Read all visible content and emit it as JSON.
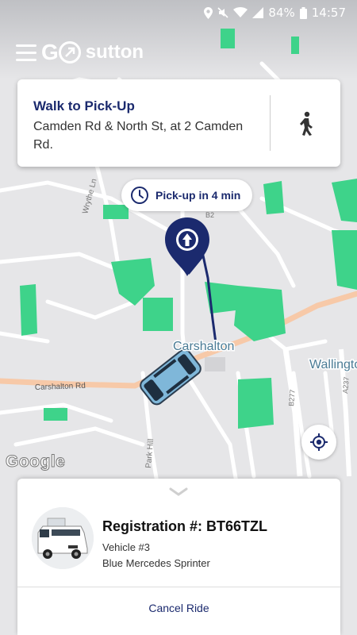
{
  "status_bar": {
    "battery": "84%",
    "time": "14:57"
  },
  "header": {
    "logo_main": "G",
    "logo_sub": "sutton"
  },
  "walk_card": {
    "title": "Walk to Pick-Up",
    "address": "Camden Rd & North St, at 2 Camden Rd."
  },
  "pickup": {
    "eta_text": "Pick-up in 4 min"
  },
  "map": {
    "labels": {
      "carshalton": "Carshalton",
      "wallington": "Wallington",
      "carshalton_rd": "Carshalton Rd",
      "park_hill": "Park Hill",
      "wrythe_ln": "Wrythe Ln",
      "b277": "B277",
      "a237": "A237",
      "b2": "B2"
    },
    "attribution": "Google"
  },
  "ride_panel": {
    "registration": "Registration #: BT66TZL",
    "vehicle_number": "Vehicle #3",
    "vehicle_description": "Blue Mercedes Sprinter",
    "cancel_label": "Cancel Ride"
  },
  "colors": {
    "brand_navy": "#1b2a6e",
    "park_green": "#3ed38a",
    "main_road": "#f7c9a8",
    "car_blue": "#7fb7d9"
  }
}
